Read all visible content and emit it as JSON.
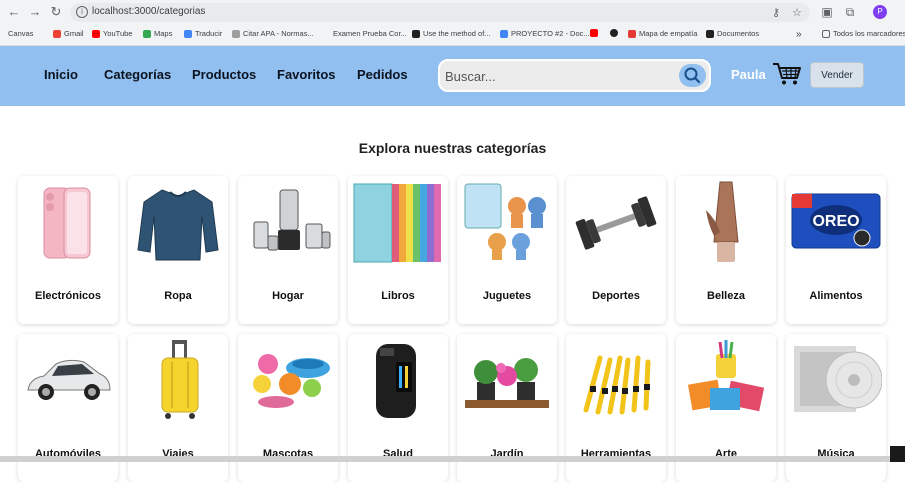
{
  "browser": {
    "url": "localhost:3000/categorias",
    "profile_initial": "P",
    "bookmarks": [
      {
        "label": "Canvas",
        "color": "#c62828"
      },
      {
        "label": "Gmail",
        "color": "#ea4335"
      },
      {
        "label": "YouTube",
        "color": "#ff0000"
      },
      {
        "label": "Maps",
        "color": "#34a853"
      },
      {
        "label": "Traducir",
        "color": "#4285f4"
      },
      {
        "label": "Citar APA - Normas...",
        "color": "#9e9e9e"
      },
      {
        "label": "Examen Prueba Cor...",
        "color": "#ffffff"
      },
      {
        "label": "Use the method of...",
        "color": "#212121"
      },
      {
        "label": "PROYECTO #2 - Doc...",
        "color": "#4285f4"
      },
      {
        "label": "",
        "color": "#ff0000"
      },
      {
        "label": "",
        "color": "#212121"
      },
      {
        "label": "Mapa de empatía",
        "color": "#e53935"
      },
      {
        "label": "Documentos",
        "color": "#212121"
      }
    ],
    "more_bookmarks": "»",
    "all_bookmarks": "Todos los marcadores"
  },
  "header": {
    "nav": [
      "Inicio",
      "Categorías",
      "Productos",
      "Favoritos",
      "Pedidos"
    ],
    "search_placeholder": "Buscar...",
    "user": "Paula",
    "sell_label": "Vender",
    "accent": "#90bff0"
  },
  "main": {
    "title": "Explora nuestras categorías",
    "categories": [
      {
        "label": "Electrónicos",
        "icon": "phone-icon"
      },
      {
        "label": "Ropa",
        "icon": "sweater-icon"
      },
      {
        "label": "Hogar",
        "icon": "kitchen-appliance-icon"
      },
      {
        "label": "Libros",
        "icon": "books-icon"
      },
      {
        "label": "Juguetes",
        "icon": "toys-icon"
      },
      {
        "label": "Deportes",
        "icon": "dumbbell-icon"
      },
      {
        "label": "Belleza",
        "icon": "cosmetic-tube-icon"
      },
      {
        "label": "Alimentos",
        "icon": "cookies-icon"
      },
      {
        "label": "Automóviles",
        "icon": "car-icon"
      },
      {
        "label": "Viajes",
        "icon": "suitcase-icon"
      },
      {
        "label": "Mascotas",
        "icon": "pet-toys-icon"
      },
      {
        "label": "Salud",
        "icon": "oximeter-icon"
      },
      {
        "label": "Jardín",
        "icon": "plants-icon"
      },
      {
        "label": "Herramientas",
        "icon": "screwdrivers-icon"
      },
      {
        "label": "Arte",
        "icon": "art-supplies-icon"
      },
      {
        "label": "Música",
        "icon": "vinyl-record-icon"
      }
    ]
  }
}
